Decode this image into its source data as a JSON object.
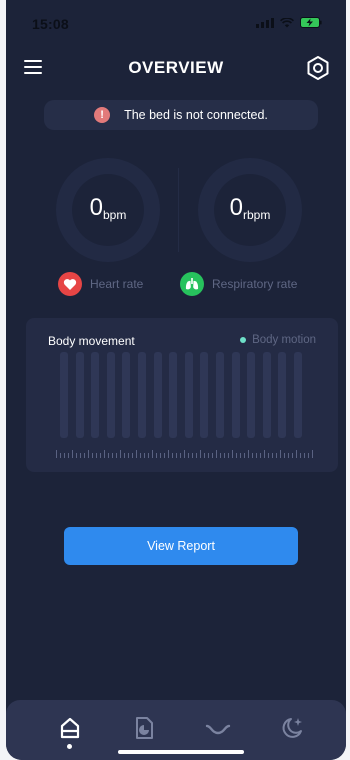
{
  "status_bar": {
    "time": "15:08"
  },
  "header": {
    "title": "OVERVIEW"
  },
  "alert": {
    "text": "The bed is not connected.",
    "icon": "!"
  },
  "metrics": {
    "heart": {
      "value": "0",
      "unit": "bpm",
      "label": "Heart  rate",
      "color": "#e64545"
    },
    "respiratory": {
      "value": "0",
      "unit": "rbpm",
      "label": "Respiratory rate",
      "color": "#27c25d"
    }
  },
  "body_movement": {
    "title": "Body movement",
    "legend": "Body motion",
    "legend_color": "#6ee0c8",
    "bar_count": 16
  },
  "actions": {
    "view_report": "View Report"
  },
  "bottom_nav": {
    "items": [
      "home-icon",
      "report-icon",
      "curve-icon",
      "sleep-icon"
    ],
    "active": 0
  },
  "colors": {
    "background": "#1c2339",
    "accent": "#2f8aee"
  }
}
